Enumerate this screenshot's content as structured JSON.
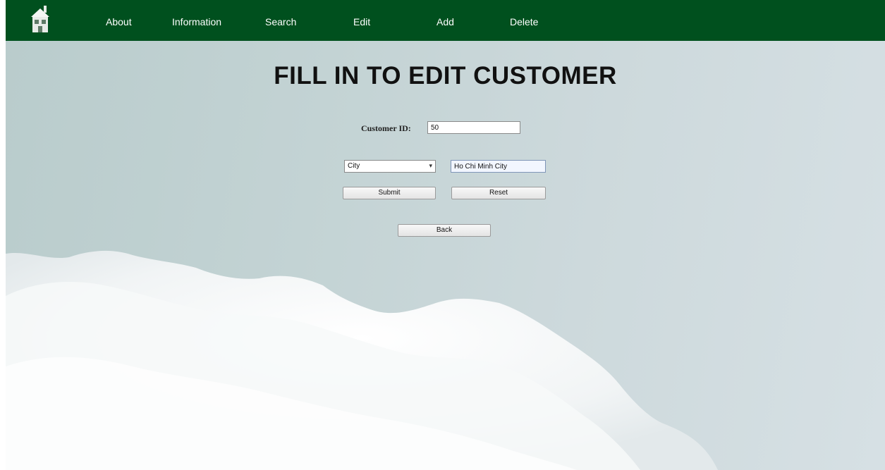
{
  "nav": {
    "logo": "house-icon",
    "items": [
      {
        "label": "About"
      },
      {
        "label": "Information"
      },
      {
        "label": "Search"
      },
      {
        "label": "Edit"
      },
      {
        "label": "Add"
      },
      {
        "label": "Delete"
      }
    ]
  },
  "page": {
    "title": "FILL IN TO EDIT CUSTOMER"
  },
  "form": {
    "customer_id_label": "Customer ID:",
    "customer_id_value": "50",
    "field_select_value": "City",
    "field_value": "Ho Chi Minh City",
    "submit_label": "Submit",
    "reset_label": "Reset",
    "back_label": "Back"
  },
  "colors": {
    "nav_bg": "#00501e",
    "sky": "#c3d3d4"
  }
}
